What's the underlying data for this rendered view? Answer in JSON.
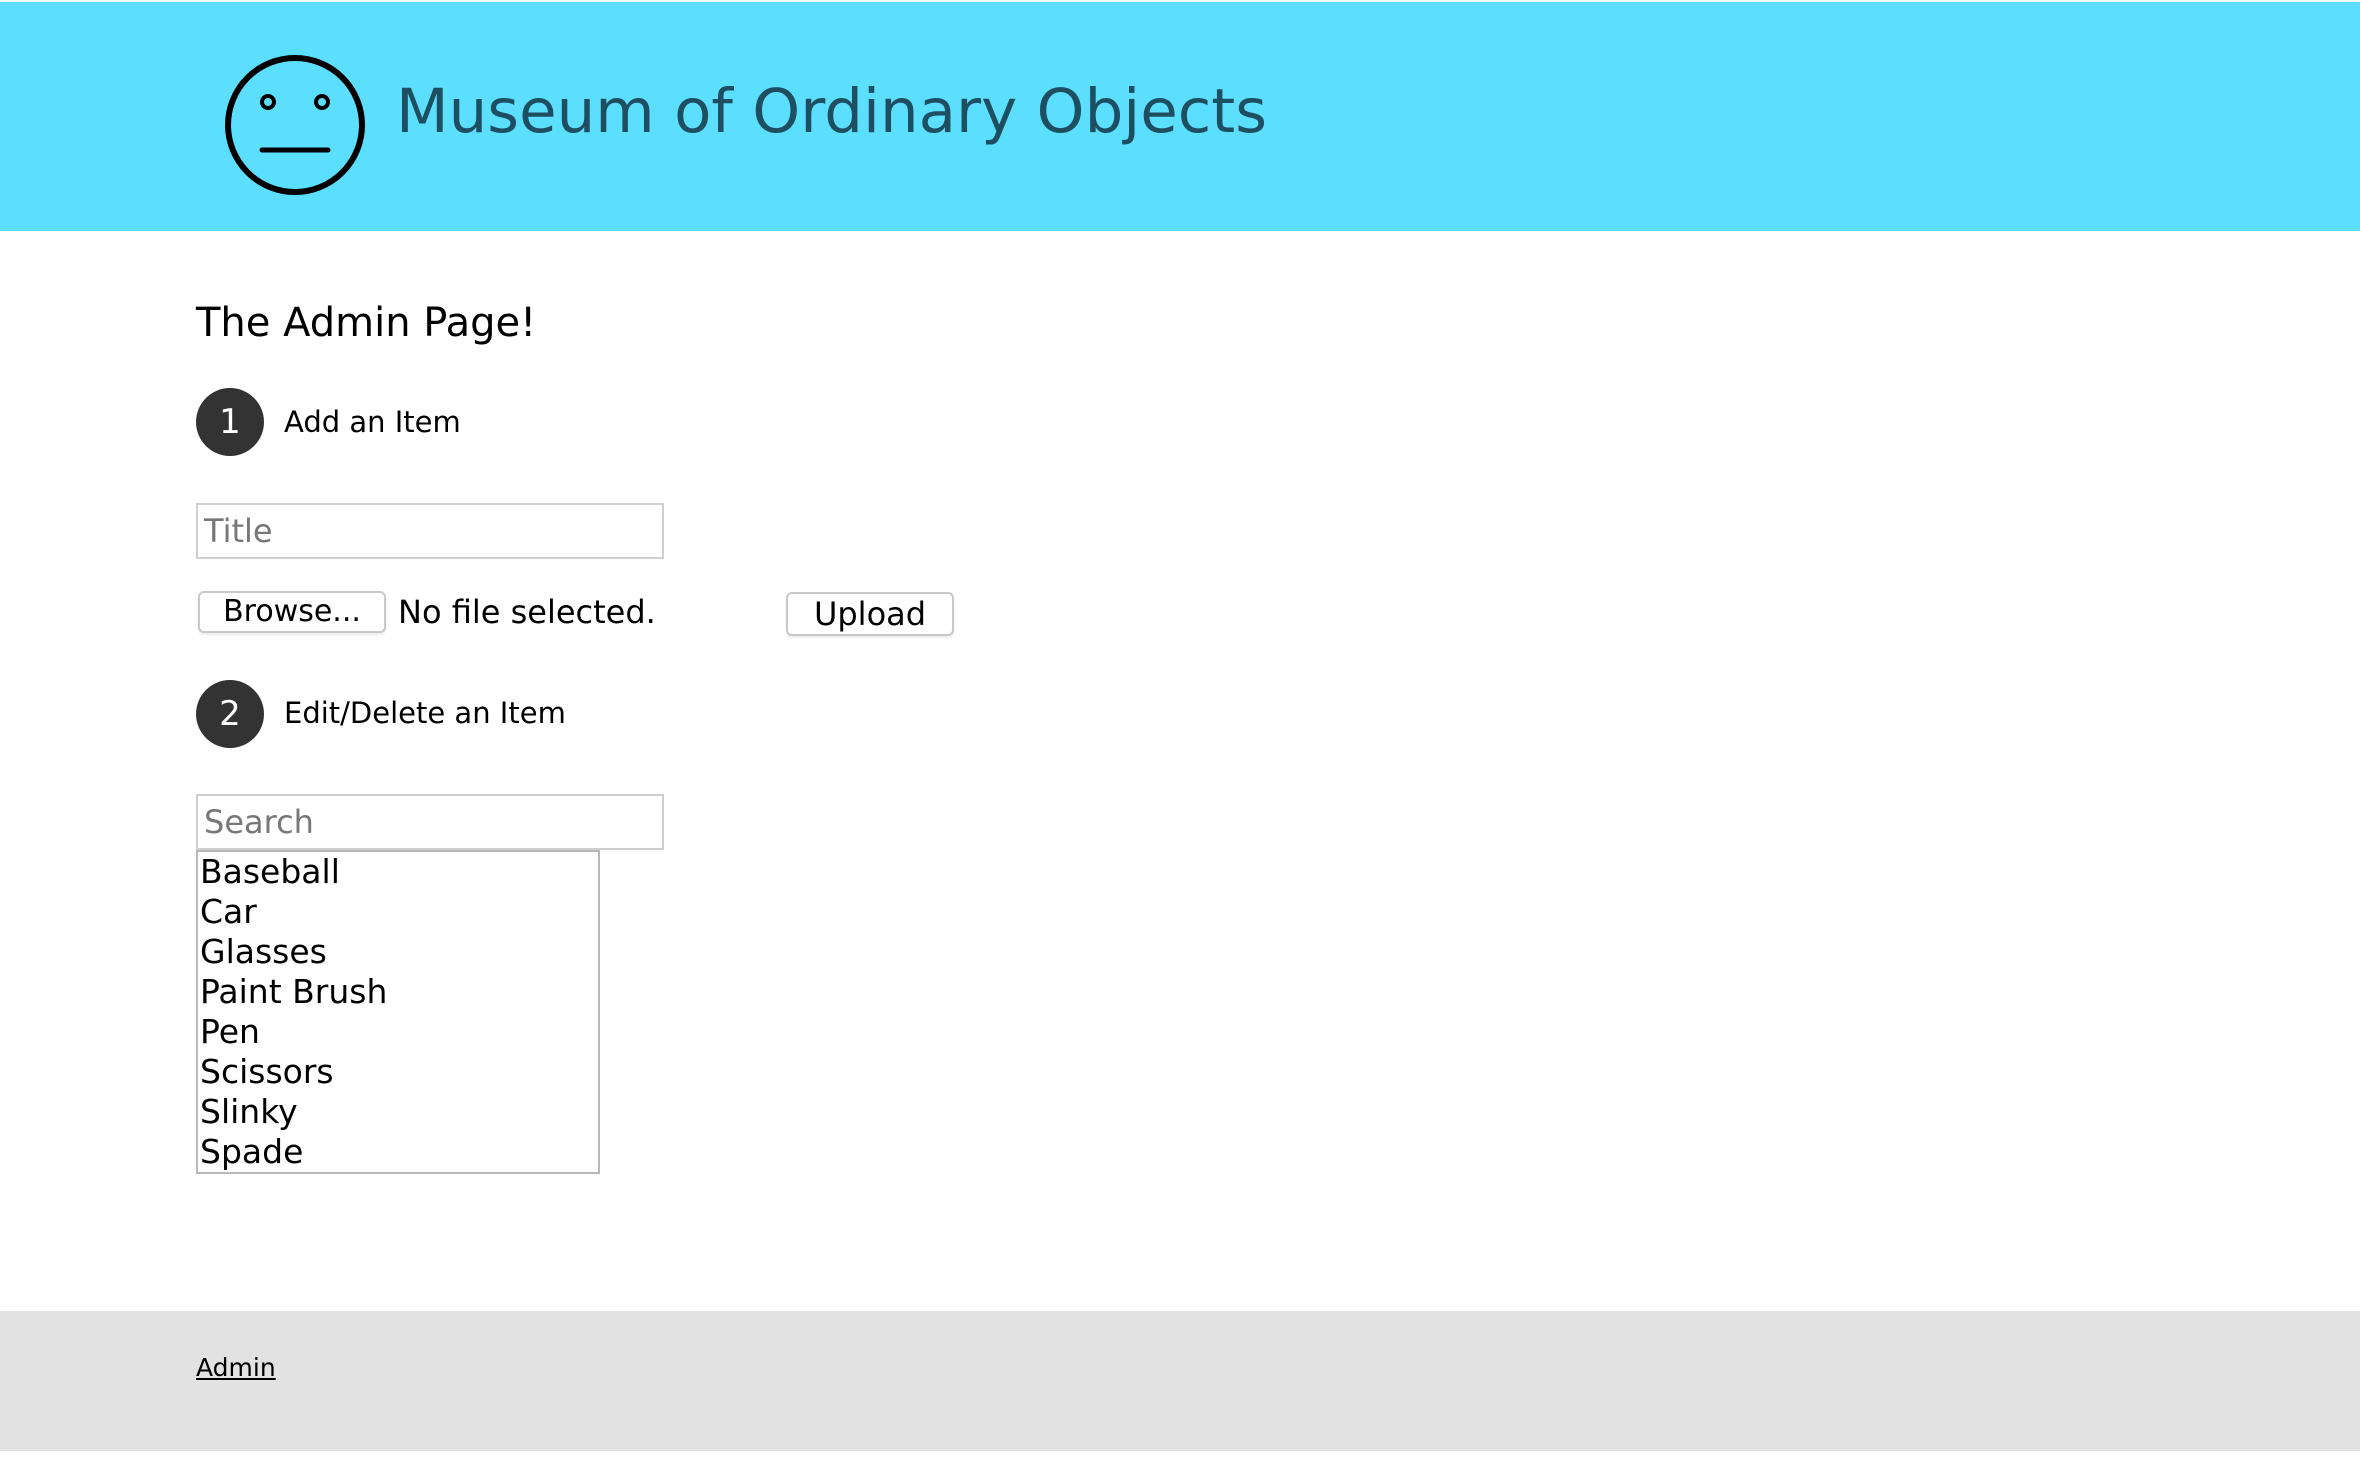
{
  "header": {
    "logo_icon": "neutral-face-icon",
    "title": "Museum of Ordinary Objects",
    "background_color": "#5cdeff",
    "title_color": "#1d4f61"
  },
  "main": {
    "heading": "The Admin Page!",
    "step1": {
      "number": "1",
      "label": "Add an Item",
      "title_placeholder": "Title",
      "browse_label": "Browse...",
      "file_status": "No file selected.",
      "upload_label": "Upload"
    },
    "step2": {
      "number": "2",
      "label": "Edit/Delete an Item",
      "search_placeholder": "Search",
      "items": [
        "Baseball",
        "Car",
        "Glasses",
        "Paint Brush",
        "Pen",
        "Scissors",
        "Slinky",
        "Spade"
      ]
    }
  },
  "footer": {
    "admin_link": "Admin",
    "background_color": "#e2e2e2"
  }
}
